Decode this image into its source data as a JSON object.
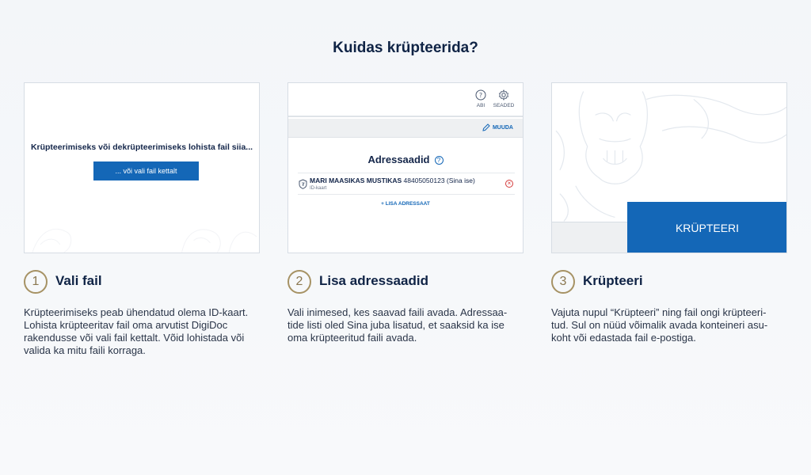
{
  "page": {
    "title": "Kuidas krüpteerida?"
  },
  "card1": {
    "drop_text": "Krüpteerimiseks või dekrüpteerimiseks lohista fail siia...",
    "pick_button": "... või vali fail kettalt"
  },
  "card2": {
    "help_label": "ABI",
    "settings_label": "SEADED",
    "edit_label": "MUUDA",
    "recipients_title": "Adressaadid",
    "recipient": {
      "name": "MARI MAASIKAS MUSTIKAS",
      "code": "48405050123 (Sina ise)",
      "type": "ID-kaart"
    },
    "add_label": "+ LISA ADRESSAAT"
  },
  "card3": {
    "encrypt_button": "KRÜPTEERI"
  },
  "steps": [
    {
      "num": "1",
      "title": "Vali fail",
      "desc": "Krüpteerimiseks peab ühendatud olema ID-kaart. Lohista krüpteeritav fail oma arvutist DigiDoc rakendusse või vali fail kettalt. Võid lohistada või valida ka mitu faili korraga."
    },
    {
      "num": "2",
      "title": "Lisa adressaadid",
      "desc": "Vali inimesed, kes saavad faili avada. Adressaa-tide listi oled Sina juba lisatud, et saaksid ka ise oma krüpteeritud faili avada."
    },
    {
      "num": "3",
      "title": "Krüpteeri",
      "desc": "Vajuta nupul “Krüpteeri” ning fail ongi krüpteeri-tud. Sul on nüüd võimalik avada konteineri asu-koht või edastada fail e-postiga."
    }
  ],
  "colors": {
    "accent": "#1467b7",
    "step_ring": "#a69264",
    "text_dark": "#0f2345"
  }
}
